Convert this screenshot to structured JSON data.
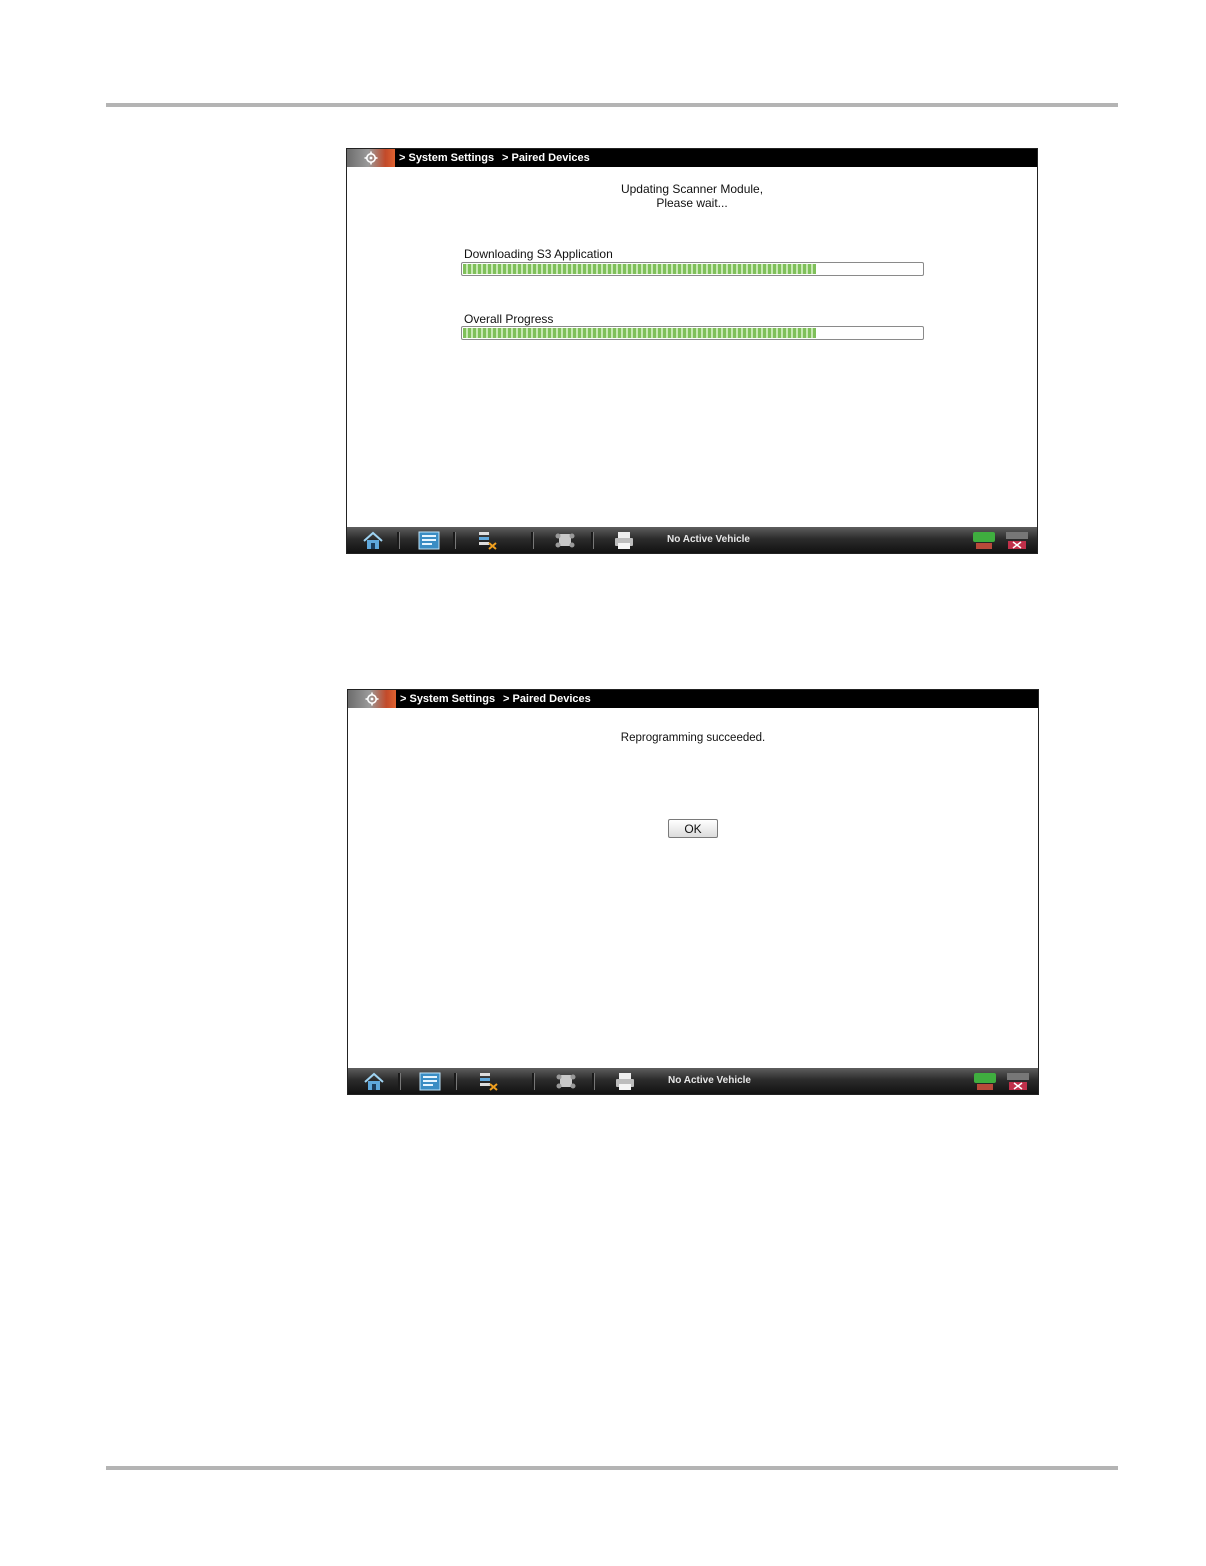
{
  "breadcrumb": {
    "item1": "> System Settings",
    "item2": "> Paired Devices"
  },
  "screen1": {
    "status_line1": "Updating Scanner Module,",
    "status_line2": "Please wait...",
    "progress": [
      {
        "label": "Downloading S3 Application",
        "fraction": 0.77
      },
      {
        "label": "Overall Progress",
        "fraction": 0.77
      }
    ]
  },
  "screen2": {
    "message": "Reprogramming succeeded.",
    "ok_label": "OK"
  },
  "toolbar": {
    "vehicle_status": "No Active Vehicle",
    "icons": [
      "home-icon",
      "scanner-icon",
      "data-list-icon",
      "vehicle-icon",
      "print-icon",
      "run-icon",
      "exit-icon"
    ]
  },
  "colors": {
    "titlebar": "#000000",
    "progress_fill": "#7fc05a",
    "accent_orange": "#e06230"
  }
}
